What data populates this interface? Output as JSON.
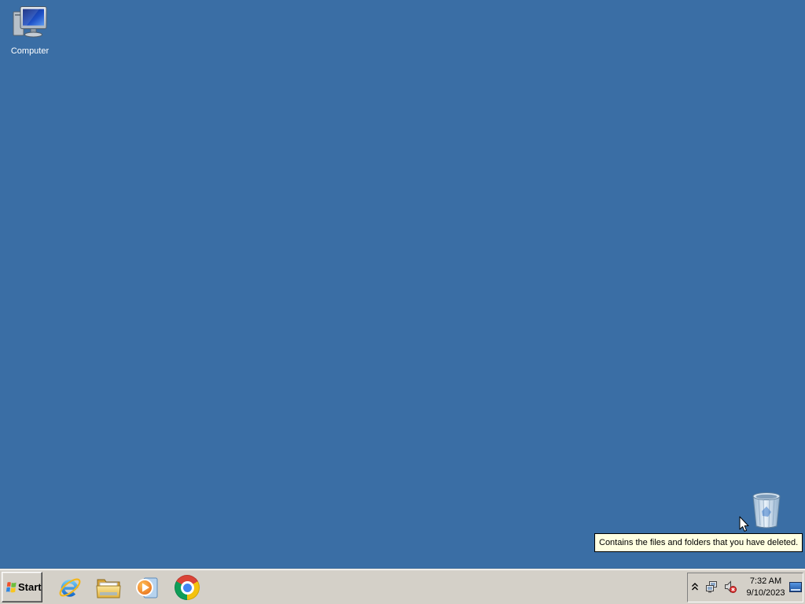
{
  "desktop": {
    "background_color": "#3A6EA5",
    "icons": [
      {
        "icon": "computer-icon",
        "label": "Computer"
      },
      {
        "icon": "recycle-bin-icon"
      }
    ]
  },
  "tooltip": {
    "text": "Contains the files and folders that you have deleted.",
    "background_color": "#FFFFE1"
  },
  "cursor": {
    "icon": "mouse-pointer-icon"
  },
  "taskbar": {
    "background_color": "#D4D0C8",
    "start_button": {
      "label": "Start",
      "icon": "windows-logo-icon"
    },
    "pinned_apps": [
      {
        "icon": "internet-explorer-icon"
      },
      {
        "icon": "windows-explorer-icon"
      },
      {
        "icon": "windows-media-player-icon"
      },
      {
        "icon": "google-chrome-icon"
      }
    ],
    "tray": {
      "icons": [
        "show-hidden-icons-icon",
        "network-icon",
        "volume-muted-icon",
        "show-desktop-icon"
      ],
      "clock": {
        "time": "7:32 AM",
        "date": "9/10/2023"
      }
    }
  }
}
